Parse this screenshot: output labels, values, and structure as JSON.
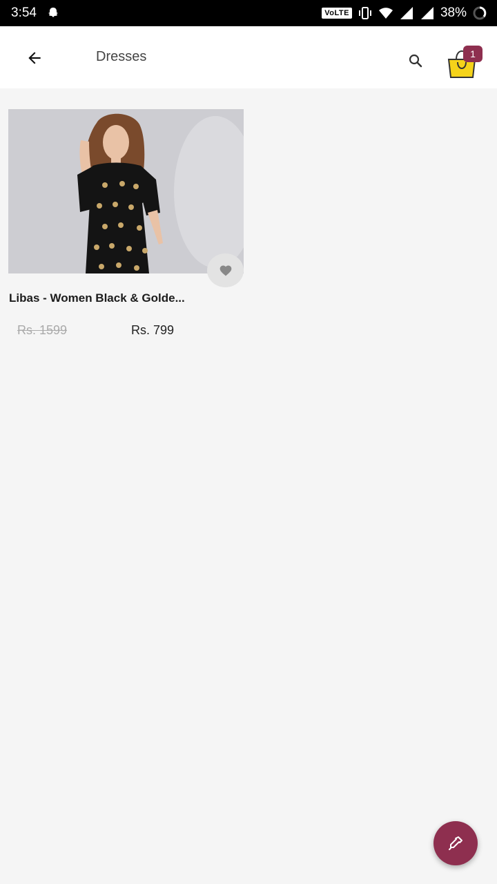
{
  "status_bar": {
    "time": "3:54",
    "volte": "VoLTE",
    "battery": "38%",
    "icons": [
      "snapchat-icon",
      "vibrate-icon",
      "wifi-icon",
      "signal-icon",
      "signal-icon",
      "battery-icon"
    ]
  },
  "app_bar": {
    "title": "Dresses",
    "cart_count": "1"
  },
  "product": {
    "name": "Libas - Women Black & Golde...",
    "price_original": "Rs. 1599",
    "price_sale": "Rs. 799"
  },
  "colors": {
    "accent": "#8e2f4f",
    "cart_yellow": "#f5d31a"
  }
}
